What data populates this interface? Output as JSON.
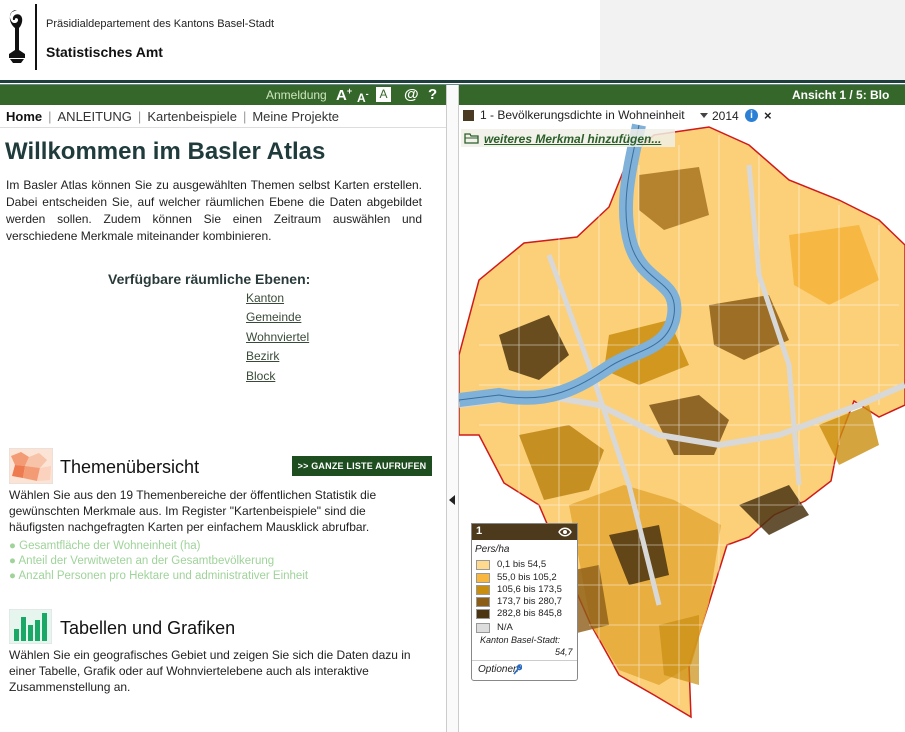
{
  "header": {
    "department": "Präsidialdepartement des Kantons Basel-Stadt",
    "office": "Statistisches Amt"
  },
  "toolbar": {
    "login": "Anmeldung",
    "font_larger": "A",
    "font_smaller": "A",
    "contrast": "A",
    "contact": "@",
    "help": "?"
  },
  "nav": {
    "items": [
      {
        "label": "Home"
      },
      {
        "label": "ANLEITUNG"
      },
      {
        "label": "Kartenbeispiele"
      },
      {
        "label": "Meine Projekte"
      }
    ]
  },
  "main": {
    "title": "Willkommen im Basler Atlas",
    "intro": "Im Basler Atlas können Sie zu ausgewählten Themen selbst Karten erstellen. Dabei entscheiden Sie, auf welcher räumlichen Ebene die Daten abgebildet werden sollen. Zudem können Sie einen Zeitraum auswählen und verschiedene Merkmale miteinander kombinieren.",
    "levels_title": "Verfügbare räumliche Ebenen:",
    "levels": [
      "Kanton",
      "Gemeinde",
      "Wohnviertel",
      "Bezirk",
      "Block"
    ]
  },
  "themen": {
    "title": "Themenübersicht",
    "button": ">> GANZE LISTE AUFRUFEN",
    "text": "Wählen Sie aus den 19 Themenbereiche der öffentlichen Statistik die gewünschten Merkmale aus. Im Register \"Kartenbeispiele\" sind die häufigsten nachgefragten Karten per einfachem Mausklick abrufbar.",
    "links": [
      "● Gesamtfläche der Wohneinheit (ha)",
      "● Anteil der Verwitweten an der Gesamtbevölkerung",
      "● Anzahl Personen pro Hektare und administrativer Einheit"
    ]
  },
  "tabellen": {
    "title": "Tabellen und Grafiken",
    "text": "Wählen Sie ein geografisches Gebiet und zeigen Sie sich die Daten dazu in einer Tabelle, Grafik oder auf Wohnviertelebene auch als interaktive Zusammenstellung an."
  },
  "map_panel": {
    "view_label": "Ansicht 1 / 5: Blo",
    "feature": "1 - Bevölkerungsdichte in Wohneinheit",
    "year": "2014",
    "info": "i",
    "close": "×",
    "add_feature": "weiteres Merkmal hinzufügen..."
  },
  "legend": {
    "number": "1",
    "unit": "Pers/ha",
    "classes": [
      {
        "label": "0,1 bis 54,5",
        "color": "#fed98e"
      },
      {
        "label": "55,0 bis 105,2",
        "color": "#f9b73f"
      },
      {
        "label": "105,6 bis 173,5",
        "color": "#c98d0f"
      },
      {
        "label": "173,7 bis 280,7",
        "color": "#8c5d16"
      },
      {
        "label": "282,8 bis 845,8",
        "color": "#4a3412"
      },
      {
        "label": "N/A",
        "color": "#dddddd"
      }
    ],
    "total_label": "Kanton Basel-Stadt:",
    "total_value": "54,7",
    "options": "Optionen"
  },
  "colors": {
    "green_bar": "#35672a",
    "button_dark": "#1e4e20",
    "title": "#1f3b3c",
    "river": "#7fb1d9",
    "border_red": "#d01a1a"
  }
}
